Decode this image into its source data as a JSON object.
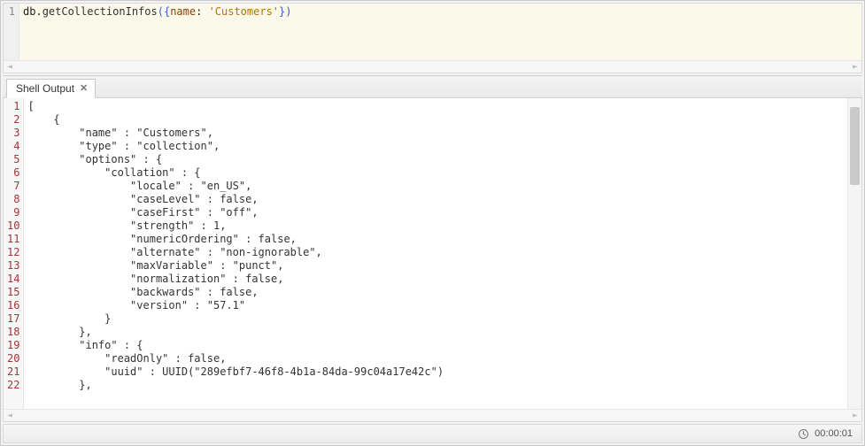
{
  "editor": {
    "gutter": [
      "1"
    ],
    "code": {
      "obj": "db",
      "dot": ".",
      "method": "getCollectionInfos",
      "lparen": "(",
      "lbrace": "{",
      "key": "name",
      "colon": ": ",
      "string": "'Customers'",
      "rbrace": "}",
      "rparen": ")"
    }
  },
  "tab": {
    "label": "Shell Output",
    "close": "✕"
  },
  "output": {
    "gutter": [
      "1",
      "2",
      "3",
      "4",
      "5",
      "6",
      "7",
      "8",
      "9",
      "10",
      "11",
      "12",
      "13",
      "14",
      "15",
      "16",
      "17",
      "18",
      "19",
      "20",
      "21",
      "22"
    ],
    "lines": [
      "[",
      "    {",
      "        \"name\" : \"Customers\",",
      "        \"type\" : \"collection\",",
      "        \"options\" : {",
      "            \"collation\" : {",
      "                \"locale\" : \"en_US\",",
      "                \"caseLevel\" : false,",
      "                \"caseFirst\" : \"off\",",
      "                \"strength\" : 1,",
      "                \"numericOrdering\" : false,",
      "                \"alternate\" : \"non-ignorable\",",
      "                \"maxVariable\" : \"punct\",",
      "                \"normalization\" : false,",
      "                \"backwards\" : false,",
      "                \"version\" : \"57.1\"",
      "            }",
      "        },",
      "        \"info\" : {",
      "            \"readOnly\" : false,",
      "            \"uuid\" : UUID(\"289efbf7-46f8-4b1a-84da-99c04a17e42c\")",
      "        },"
    ]
  },
  "status": {
    "elapsed": "00:00:01"
  },
  "scroll_arrows": {
    "left": "◄",
    "right": "►"
  }
}
